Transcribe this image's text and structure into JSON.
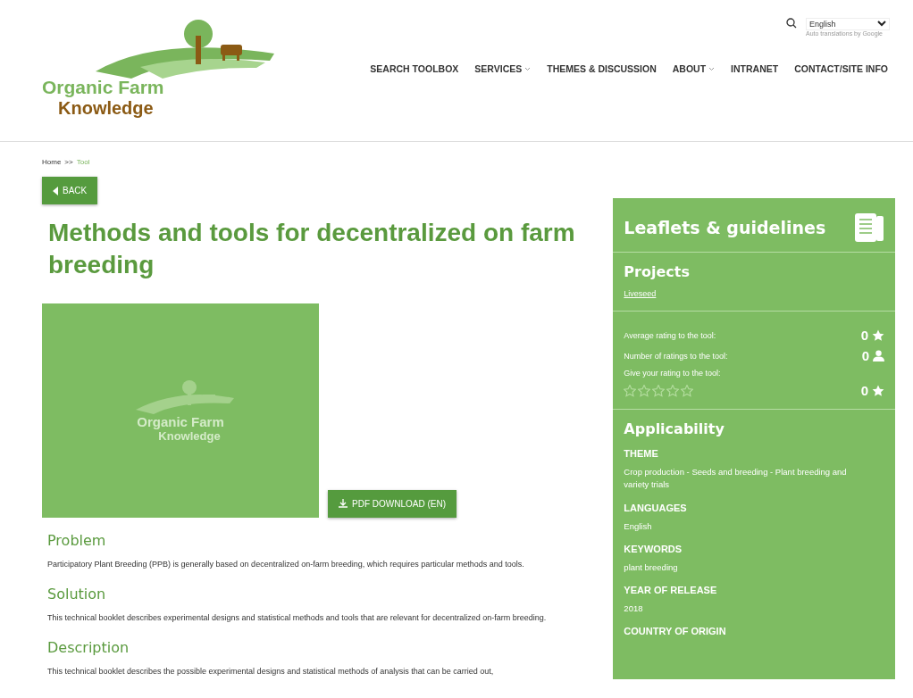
{
  "header": {
    "logo": {
      "line1": "Organic Farm",
      "line2": "Knowledge"
    },
    "language": {
      "value": "English",
      "note": "Auto translations by Google"
    },
    "nav": [
      {
        "label": "SEARCH TOOLBOX",
        "dropdown": false
      },
      {
        "label": "SERVICES",
        "dropdown": true
      },
      {
        "label": "THEMES & DISCUSSION",
        "dropdown": false
      },
      {
        "label": "ABOUT",
        "dropdown": true
      },
      {
        "label": "INTRANET",
        "dropdown": false
      },
      {
        "label": "CONTACT/SITE INFO",
        "dropdown": false
      }
    ]
  },
  "breadcrumb": {
    "home": "Home",
    "separator": ">>",
    "current": "Tool"
  },
  "back_button": "BACK",
  "title": "Methods and tools for decentralized on farm breeding",
  "image": {
    "line1": "Organic Farm",
    "line2": "Knowledge"
  },
  "download_button": "PDF DOWNLOAD (EN)",
  "sections": [
    {
      "heading": "Problem",
      "text": "Participatory Plant Breeding (PPB) is generally based on decentralized on-farm breeding, which requires particular methods and tools."
    },
    {
      "heading": "Solution",
      "text": "This technical booklet describes experimental designs and statistical methods and tools that are relevant for decentralized on-farm breeding."
    },
    {
      "heading": "Description",
      "text": "This technical booklet describes the possible experimental designs and statistical methods of analysis that can be carried out,"
    }
  ],
  "sidebar": {
    "title": "Leaflets & guidelines",
    "projects_heading": "Projects",
    "project_link": "Liveseed",
    "ratings": [
      {
        "kind": "average",
        "label": "Average rating to the tool:",
        "value": "0"
      },
      {
        "kind": "count",
        "label": "Number of ratings to the tool:",
        "value": "0"
      }
    ],
    "give_rating": {
      "label": "Give your rating to the tool:",
      "stars": 0,
      "value": "0"
    },
    "applicability_heading": "Applicability",
    "fields": [
      {
        "label": "THEME",
        "value": "Crop production - Seeds and breeding - Plant breeding and variety trials"
      },
      {
        "label": "LANGUAGES",
        "value": "English"
      },
      {
        "label": "KEYWORDS",
        "value": "plant breeding"
      },
      {
        "label": "YEAR OF RELEASE",
        "value": "2018"
      },
      {
        "label": "COUNTRY OF ORIGIN"
      }
    ]
  }
}
